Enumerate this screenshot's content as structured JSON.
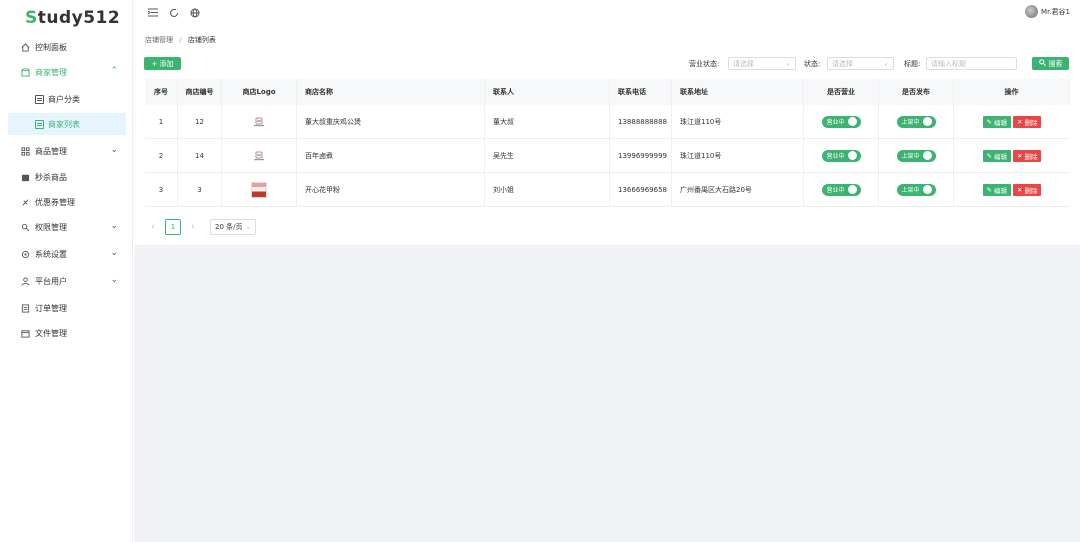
{
  "app": {
    "logo_first": "S",
    "logo_rest": "tudy512"
  },
  "header": {
    "user_name": "Mr.君谷1"
  },
  "sidebar": {
    "items": [
      {
        "label": "控制面板",
        "icon": "home-icon"
      },
      {
        "label": "商家管理",
        "icon": "shop-icon",
        "expanded": true
      },
      {
        "label": "商户分类",
        "icon": "list-icon"
      },
      {
        "label": "商家列表",
        "icon": "list-icon",
        "active": true
      },
      {
        "label": "商品管理",
        "icon": "grid-icon"
      },
      {
        "label": "秒杀商品",
        "icon": "flash-icon"
      },
      {
        "label": "优惠券管理",
        "icon": "ticket-icon"
      },
      {
        "label": "权限管理",
        "icon": "key-icon"
      },
      {
        "label": "系统设置",
        "icon": "gear-icon"
      },
      {
        "label": "平台用户",
        "icon": "user-icon"
      },
      {
        "label": "订单管理",
        "icon": "order-icon"
      },
      {
        "label": "文件管理",
        "icon": "file-icon"
      }
    ]
  },
  "breadcrumb": {
    "parent": "店铺管理",
    "separator": "/",
    "current": "店铺列表"
  },
  "toolbar": {
    "add_label": "+ 添加",
    "business_status_label": "营业状态:",
    "business_status_placeholder": "请选择",
    "status_label": "状态:",
    "status_placeholder": "请选择",
    "title_label": "标题:",
    "title_placeholder": "请输入标题",
    "search_label": "搜索"
  },
  "table": {
    "headers": [
      "序号",
      "商店编号",
      "商店Logo",
      "商店名称",
      "联系人",
      "联系电话",
      "联系地址",
      "是否营业",
      "是否发布",
      "操作"
    ],
    "rows": [
      {
        "index": "1",
        "shop_no": "12",
        "name": "董大叔重庆鸡公煲",
        "contact": "董大叔",
        "phone": "13888888888",
        "address": "珠江道110号",
        "open_label": "营业中",
        "publish_label": "上架中",
        "logo": "robot-logo"
      },
      {
        "index": "2",
        "shop_no": "14",
        "name": "百年卤煮",
        "contact": "吴先生",
        "phone": "13996999999",
        "address": "珠江道110号",
        "open_label": "营业中",
        "publish_label": "上架中",
        "logo": "robot-logo"
      },
      {
        "index": "3",
        "shop_no": "3",
        "name": "开心花甲粉",
        "contact": "刘小姐",
        "phone": "13666969658",
        "address": "广州番禺区大石路20号",
        "open_label": "营业中",
        "publish_label": "上架中",
        "logo": "shop-photo"
      }
    ],
    "edit_label": "编辑",
    "delete_label": "删除"
  },
  "pagination": {
    "current_page": "1",
    "page_size_label": "20 条/页"
  },
  "colors": {
    "accent": "#3cb371",
    "danger": "#e8474a",
    "active_bg": "#e6f4ff"
  }
}
